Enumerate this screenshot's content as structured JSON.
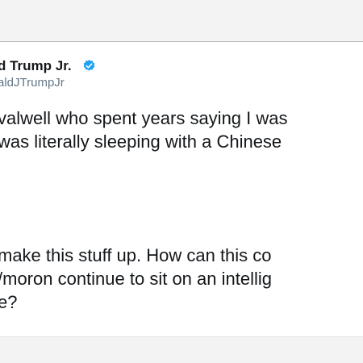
{
  "tweet": {
    "author_name": "d Trump Jr.",
    "author_handle": "aldJTrumpJr",
    "verified": true,
    "verified_color": "#1da1f2",
    "paragraph1_lines": [
      "valwell who spent years saying I was",
      "was literally sleeping with a Chinese"
    ],
    "paragraph2_lines": [
      "make this stuff up. How can this co",
      "/moron continue to sit on an intellig",
      "e?"
    ]
  }
}
